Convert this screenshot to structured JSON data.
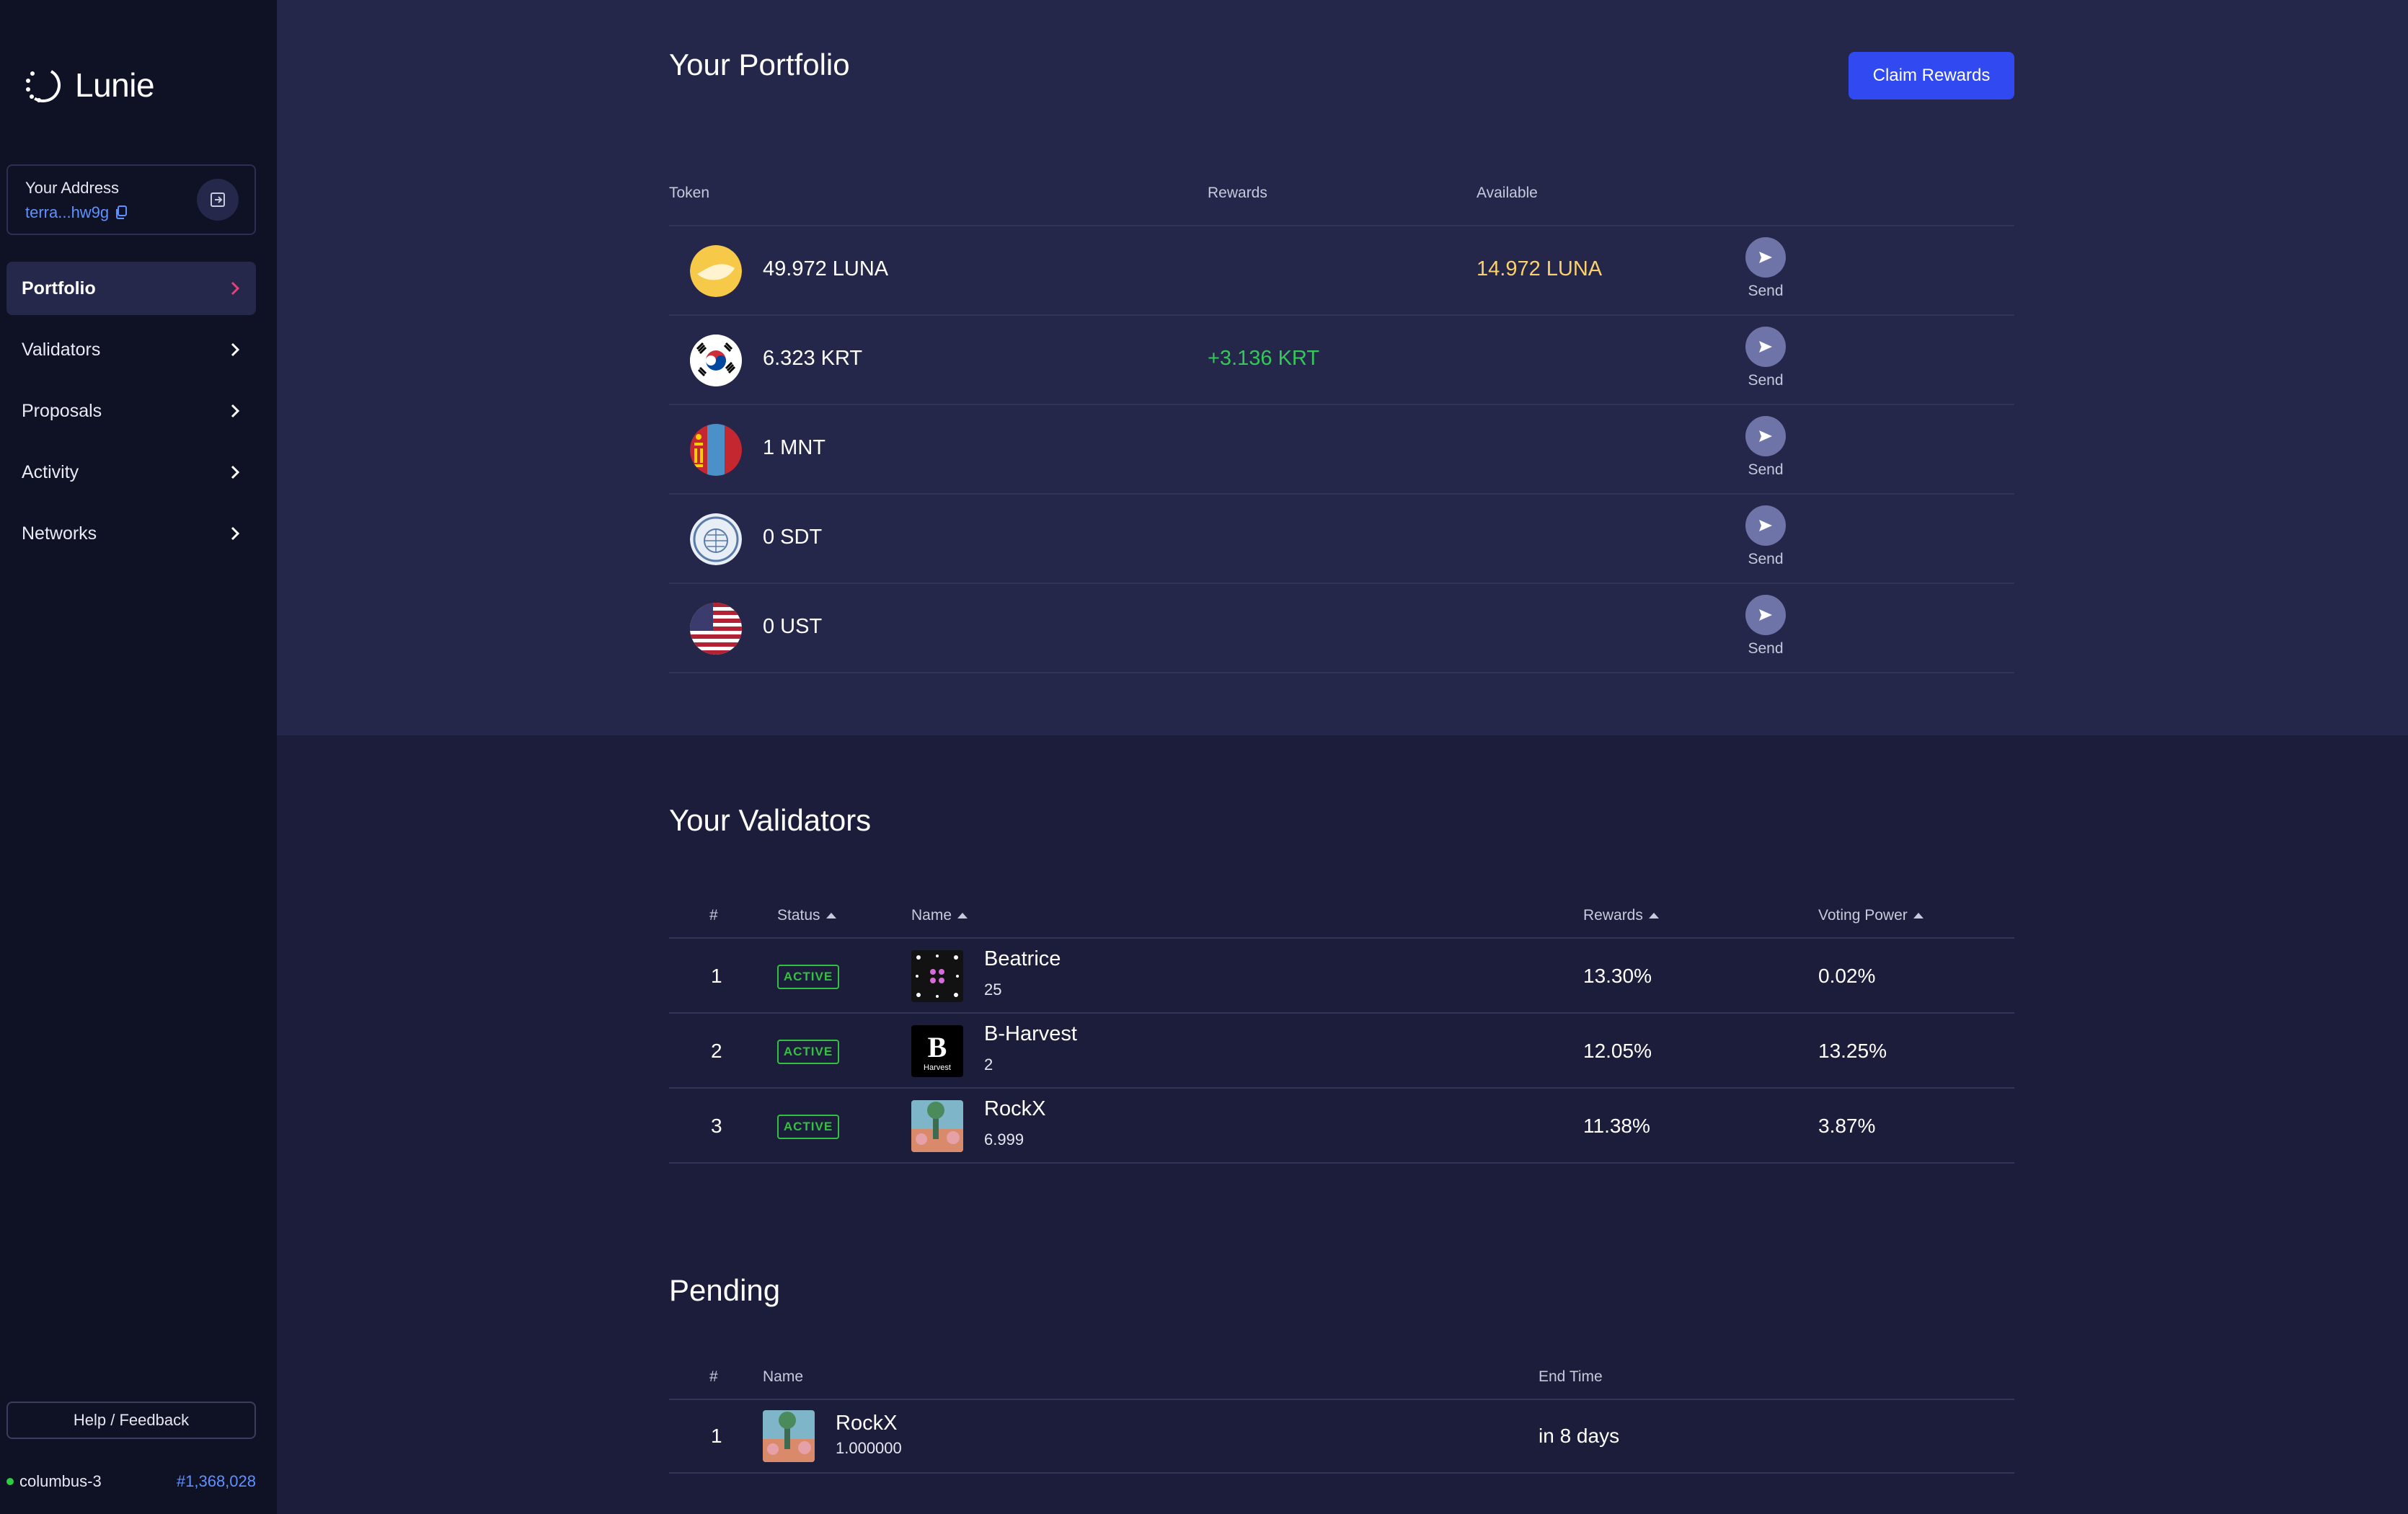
{
  "app": {
    "name": "Lunie"
  },
  "sidebar": {
    "address_label": "Your Address",
    "address_value": "terra...hw9g",
    "nav": [
      {
        "label": "Portfolio",
        "active": true
      },
      {
        "label": "Validators",
        "active": false
      },
      {
        "label": "Proposals",
        "active": false
      },
      {
        "label": "Activity",
        "active": false
      },
      {
        "label": "Networks",
        "active": false
      }
    ],
    "help_label": "Help / Feedback",
    "network_name": "columbus-3",
    "block_height": "#1,368,028"
  },
  "portfolio": {
    "title": "Your Portfolio",
    "claim_label": "Claim Rewards",
    "headers": {
      "token": "Token",
      "rewards": "Rewards",
      "available": "Available"
    },
    "send_label": "Send",
    "tokens": [
      {
        "amount": "49.972 LUNA",
        "rewards": "",
        "available": "14.972 LUNA",
        "icon": "luna-icon"
      },
      {
        "amount": "6.323 KRT",
        "rewards": "+3.136 KRT",
        "available": "",
        "icon": "korea-flag-icon"
      },
      {
        "amount": "1 MNT",
        "rewards": "",
        "available": "",
        "icon": "mongolia-flag-icon"
      },
      {
        "amount": "0 SDT",
        "rewards": "",
        "available": "",
        "icon": "imf-seal-icon"
      },
      {
        "amount": "0 UST",
        "rewards": "",
        "available": "",
        "icon": "usa-flag-icon"
      }
    ]
  },
  "validators": {
    "title": "Your Validators",
    "headers": {
      "rank": "#",
      "status": "Status",
      "name": "Name",
      "rewards": "Rewards",
      "voting_power": "Voting Power"
    },
    "rows": [
      {
        "rank": "1",
        "status": "ACTIVE",
        "name": "Beatrice",
        "sub": "25",
        "rewards": "13.30%",
        "voting_power": "0.02%"
      },
      {
        "rank": "2",
        "status": "ACTIVE",
        "name": "B-Harvest",
        "sub": "2",
        "rewards": "12.05%",
        "voting_power": "13.25%"
      },
      {
        "rank": "3",
        "status": "ACTIVE",
        "name": "RockX",
        "sub": "6.999",
        "rewards": "11.38%",
        "voting_power": "3.87%"
      }
    ]
  },
  "pending": {
    "title": "Pending",
    "headers": {
      "rank": "#",
      "name": "Name",
      "end_time": "End Time"
    },
    "rows": [
      {
        "rank": "1",
        "name": "RockX",
        "sub": "1.000000",
        "end_time": "in 8 days"
      }
    ]
  },
  "colors": {
    "accent": "#3049f0",
    "link": "#5f91ff",
    "positive": "#35c759",
    "available": "#fbd16e",
    "active_badge": "#34c040"
  }
}
